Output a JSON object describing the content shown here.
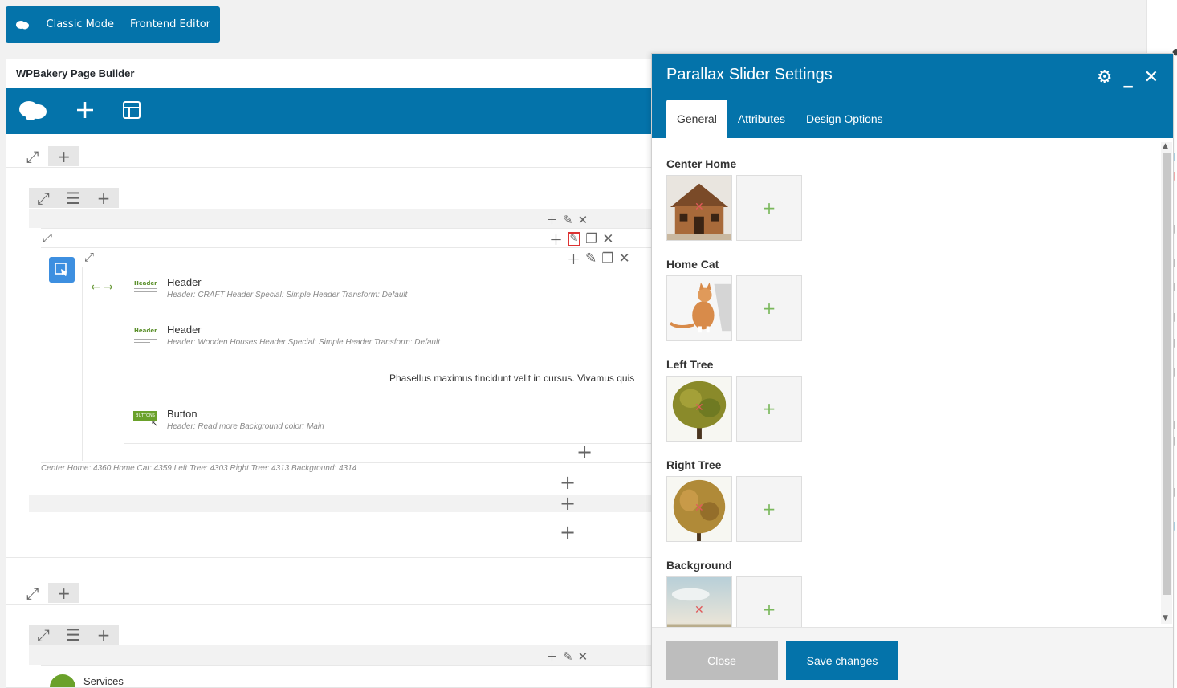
{
  "modebar": {
    "classic": "Classic Mode",
    "frontend": "Frontend Editor"
  },
  "builder": {
    "title": "WPBakery Page Builder",
    "elements": [
      {
        "title": "Header",
        "meta": "Header: CRAFT  Header Special: Simple Header  Transform: Default"
      },
      {
        "title": "Header",
        "meta": "Header: Wooden Houses  Header Special: Simple Header  Transform: Default"
      },
      {
        "title": "Button",
        "meta": "Header: Read more  Background color: Main"
      }
    ],
    "text_block": "Phasellus maximus tincidunt velit in cursus. Vivamus quis",
    "slider_meta": "Center Home: 4360  Home Cat: 4359  Left Tree: 4303  Right Tree: 4313  Background: 4314",
    "services_label": "Services",
    "thumb_header_label": "Header",
    "thumb_button_label": "BUTTONS"
  },
  "modal": {
    "title": "Parallax Slider Settings",
    "tabs": [
      "General",
      "Attributes",
      "Design Options"
    ],
    "active_tab": "General",
    "fields": [
      {
        "label": "Center Home",
        "image": "log cabin house"
      },
      {
        "label": "Home Cat",
        "image": "sitting cat"
      },
      {
        "label": "Left Tree",
        "image": "green-yellow tree"
      },
      {
        "label": "Right Tree",
        "image": "autumn tree"
      },
      {
        "label": "Background",
        "image": "pale sky"
      }
    ],
    "close_label": "Close",
    "save_label": "Save changes"
  },
  "colors": {
    "brand": "#0473aa",
    "add": "#7ab85c",
    "remove": "#e05a5a"
  }
}
